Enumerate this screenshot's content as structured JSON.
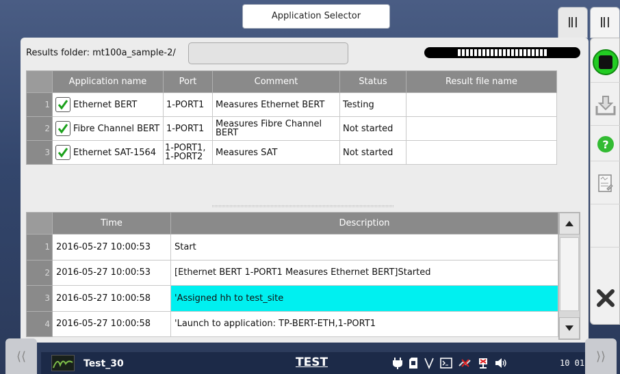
{
  "title_tab": "Application Selector",
  "results": {
    "label": "Results folder: mt100a_sample-2/",
    "input_value": "",
    "progress_text": "||||||||||||||||"
  },
  "app_table": {
    "headers": [
      "Application name",
      "Port",
      "Comment",
      "Status",
      "Result file name"
    ],
    "rows": [
      {
        "num": "1",
        "name": "Ethernet BERT",
        "port": "1-PORT1",
        "comment": "Measures Ethernet BERT",
        "status": "Testing",
        "result": ""
      },
      {
        "num": "2",
        "name": "Fibre Channel BERT",
        "port": "1-PORT1",
        "comment": "Measures Fibre Channel BERT",
        "status": "Not started",
        "result": ""
      },
      {
        "num": "3",
        "name": "Ethernet SAT-1564",
        "port": "1-PORT1, 1-PORT2",
        "comment": "Measures SAT",
        "status": "Not started",
        "result": ""
      }
    ]
  },
  "log_table": {
    "headers": [
      "Time",
      "Description"
    ],
    "rows": [
      {
        "num": "1",
        "time": "2016-05-27 10:00:53",
        "desc": "Start"
      },
      {
        "num": "2",
        "time": "2016-05-27 10:00:53",
        "desc": "[Ethernet BERT 1-PORT1 Measures Ethernet BERT]Started"
      },
      {
        "num": "3",
        "time": "2016-05-27 10:00:58",
        "desc": "'Assigned hh to test_site"
      },
      {
        "num": "4",
        "time": "2016-05-27 10:00:58",
        "desc": "'Launch to application: TP-BERT-ETH,1-PORT1"
      }
    ]
  },
  "side_buttons": [
    "stop-icon",
    "save-icon",
    "help-icon",
    "report-icon",
    "close-icon"
  ],
  "status_bar": {
    "test_name": "Test_30",
    "mode": "TEST",
    "time": "10 01",
    "icons": [
      "power-plug-icon",
      "sd-card-icon",
      "v-icon",
      "terminal-icon",
      "no-network-icon",
      "network-error-icon",
      "speaker-icon"
    ]
  },
  "colors": {
    "highlight": "#00f0f0",
    "stop_green": "#22cc22",
    "help_green": "#33bb33",
    "header_gray": "#8a8a8a"
  }
}
